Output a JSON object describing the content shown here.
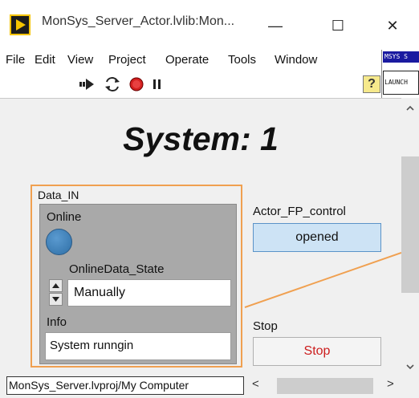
{
  "window": {
    "title": "MonSys_Server_Actor.lvlib:Mon...",
    "minimize_glyph": "—",
    "maximize_glyph": "☐",
    "close_glyph": "✕"
  },
  "menu": [
    "File",
    "Edit",
    "View",
    "Project",
    "Operate",
    "Tools",
    "Window"
  ],
  "toolbar": {
    "icons": [
      "run-arrow-icon",
      "run-continuously-icon",
      "abort-icon",
      "pause-icon"
    ],
    "help_glyph": "?"
  },
  "launcher": {
    "top_label": "MSYS S",
    "bottom_label": "LAUNCH"
  },
  "panel": {
    "title": "System: 1",
    "cluster": {
      "label": "Data_IN",
      "online_label": "Online",
      "online_state": true,
      "state_label": "OnlineData_State",
      "state_value": "Manually",
      "info_label": "Info",
      "info_value": "System runngin"
    },
    "actor_fp": {
      "label": "Actor_FP_control",
      "value": "opened"
    },
    "stop": {
      "label": "Stop",
      "button": "Stop"
    }
  },
  "statusbar": {
    "path": "MonSys_Server.lvproj/My Computer",
    "left_arrow": "<",
    "right_arrow": ">"
  },
  "colors": {
    "cluster_border": "#f0a050",
    "led_on": "#3d7fbf",
    "stop_text": "#cc1d1d",
    "fp_button": "#cde3f5",
    "app_icon": "#f5c400"
  }
}
